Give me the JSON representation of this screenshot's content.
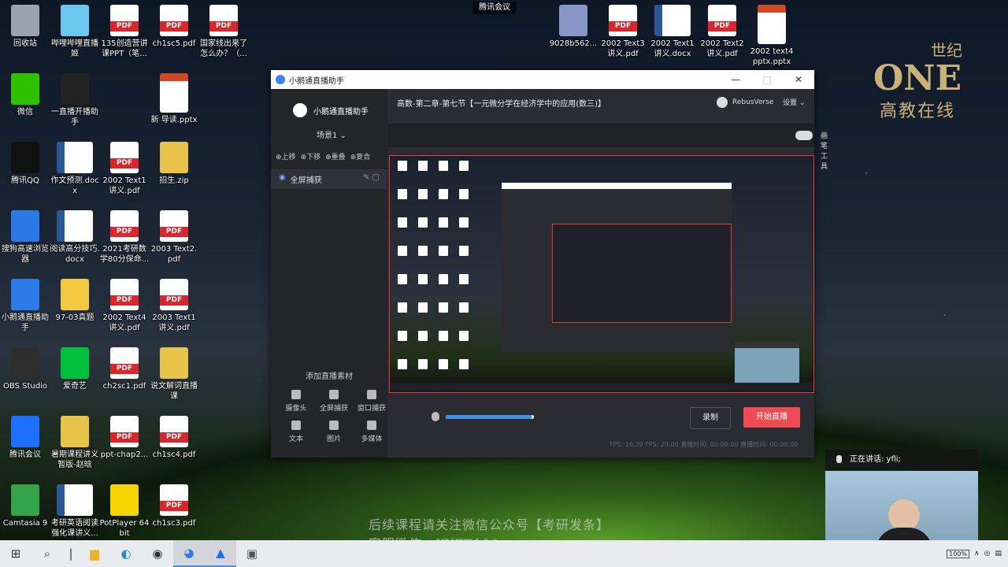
{
  "desktop": {
    "icons": [
      {
        "label": "回收站",
        "type": "app",
        "color": "#9aa4ae"
      },
      {
        "label": "哔哩哔哩直播姬",
        "type": "app",
        "color": "#6cc7f0"
      },
      {
        "label": "135创造营讲课PPT（笔...",
        "type": "pdf"
      },
      {
        "label": "ch1sc5.pdf",
        "type": "pdf"
      },
      {
        "label": "国家线出来了怎么办？（...",
        "type": "pdf"
      },
      {
        "label": "微信",
        "type": "app",
        "color": "#2dc100"
      },
      {
        "label": "一直播开播助手",
        "type": "app",
        "color": "#222"
      },
      {
        "label": "新 导读.pptx",
        "type": "pptx"
      },
      {
        "label": "腾讯QQ",
        "type": "app",
        "color": "#111"
      },
      {
        "label": "作文预测.docx",
        "type": "docx"
      },
      {
        "label": "2002 Text1讲义.pdf",
        "type": "pdf"
      },
      {
        "label": "招生.zip",
        "type": "zip"
      },
      {
        "label": "搜狗高速浏览器",
        "type": "app",
        "color": "#2a79e6"
      },
      {
        "label": "阅读高分技巧.docx",
        "type": "docx"
      },
      {
        "label": "2021考研数学80分保命...",
        "type": "pdf"
      },
      {
        "label": "2003 Text2.pdf",
        "type": "pdf"
      },
      {
        "label": "小鹅通直播助手",
        "type": "app",
        "color": "#2d7be8"
      },
      {
        "label": "97-03真题",
        "type": "folder"
      },
      {
        "label": "2002 Text4讲义.pdf",
        "type": "pdf"
      },
      {
        "label": "2003 Text1讲义.pdf",
        "type": "pdf"
      },
      {
        "label": "OBS Studio",
        "type": "app",
        "color": "#2d2d2d"
      },
      {
        "label": "爱奇艺",
        "type": "app",
        "color": "#00c13b"
      },
      {
        "label": "ch2sc1.pdf",
        "type": "pdf"
      },
      {
        "label": "说文解词直播课",
        "type": "zip"
      },
      {
        "label": "腾讯会议",
        "type": "app",
        "color": "#1e6fff"
      },
      {
        "label": "暑期课程讲义暂版-赵晗",
        "type": "zip"
      },
      {
        "label": "ppt-chap2...",
        "type": "pdf"
      },
      {
        "label": "ch1sc4.pdf",
        "type": "pdf"
      },
      {
        "label": "Camtasia 9",
        "type": "app",
        "color": "#34a34a"
      },
      {
        "label": "考研英语阅读强化课讲义...",
        "type": "docx"
      },
      {
        "label": "PotPlayer 64 bit",
        "type": "app",
        "color": "#f5d400"
      },
      {
        "label": "ch1sc3.pdf",
        "type": "pdf"
      },
      {
        "label": "9028b562...",
        "type": "app",
        "color": "#8896c8"
      },
      {
        "label": "2002 Text3讲义.pdf",
        "type": "pdf"
      },
      {
        "label": "2002 Text1讲义.docx",
        "type": "docx"
      },
      {
        "label": "2002 Text2讲义.pdf",
        "type": "pdf"
      },
      {
        "label": "2002 text4 pptx.pptx",
        "type": "pptx"
      }
    ]
  },
  "meeting_tag": "腾讯会议",
  "logo": {
    "brand": "ONE",
    "small": "世纪",
    "sub": "高教在线"
  },
  "app": {
    "window_title": "小鹅通直播助手",
    "controls": {
      "minimize": "—",
      "maximize": "□",
      "close": "✕"
    },
    "brand_name": "小鹅通直播助手",
    "scene": "场景1",
    "source_tools": [
      "上移",
      "下移",
      "重叠",
      "复合"
    ],
    "source_item": "全屏捕获",
    "course_title": "高数-第二章-第七节【一元微分学在经济学中的应用(数三)】",
    "user_name": "RebusVerse",
    "settings": "设置",
    "toggle_label": "画笔工具",
    "add_source": "添加直播素材",
    "sources": [
      "摄像头",
      "全屏捕获",
      "窗口捕获",
      "文本",
      "图片",
      "多媒体"
    ],
    "volume": 0.97,
    "record": "录制",
    "start_live": "开始直播",
    "stats": "FPS: 16.39  FPS: 29.00  直播时间: 00:00:00  直播时间: 00:00:00"
  },
  "speaker": {
    "label": "正在讲话: yfli;",
    "video_name": "yfli"
  },
  "watermark": {
    "line1": "后续课程请关注微信公众号【考研发条】",
    "line2": "客服微信：KYFT100"
  },
  "taskbar": {
    "battery": "100%"
  }
}
